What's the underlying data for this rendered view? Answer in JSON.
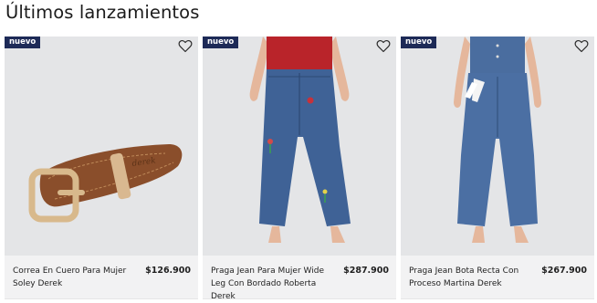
{
  "section": {
    "title": "Últimos lanzamientos"
  },
  "products": [
    {
      "badge": "nuevo",
      "name": "Correa En Cuero Para Mujer Soley Derek",
      "price": "$126.900",
      "favorite_icon": "heart-outline-icon"
    },
    {
      "badge": "nuevo",
      "name": "Praga Jean Para Mujer Wide Leg Con Bordado Roberta Derek",
      "price": "$287.900",
      "favorite_icon": "heart-outline-icon"
    },
    {
      "badge": "nuevo",
      "name": "Praga Jean Bota Recta Con Proceso Martina Derek",
      "price": "$267.900",
      "favorite_icon": "heart-outline-icon"
    }
  ],
  "colors": {
    "badge_bg": "#1d2a57",
    "media_bg": "#e4e5e7",
    "info_bg": "#f2f2f3",
    "denim": "#3f6296"
  }
}
